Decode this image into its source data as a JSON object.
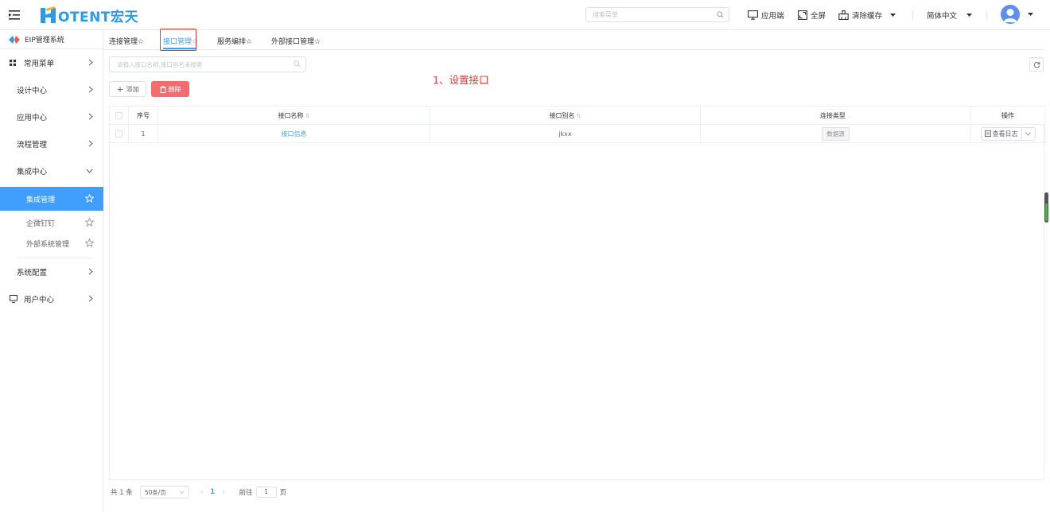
{
  "header": {
    "logo_text": "OTENT宏天",
    "search_placeholder": "搜索菜单",
    "app_client": "应用端",
    "fullscreen": "全屏",
    "clear_cache": "清除缓存",
    "language": "简体中文"
  },
  "sidebar": {
    "system_title": "EIP管理系统",
    "items": [
      {
        "label": "常用菜单"
      },
      {
        "label": "设计中心"
      },
      {
        "label": "应用中心"
      },
      {
        "label": "流程管理"
      },
      {
        "label": "集成中心"
      },
      {
        "label": "系统配置"
      },
      {
        "label": "用户中心"
      }
    ],
    "sub_items": [
      {
        "label": "集成管理",
        "active": true
      },
      {
        "label": "企微钉钉",
        "active": false
      },
      {
        "label": "外部系统管理",
        "active": false
      }
    ]
  },
  "tabs": [
    {
      "label": "连接管理☆",
      "active": false
    },
    {
      "label": "接口管理☆",
      "active": true
    },
    {
      "label": "服务编排☆",
      "active": false
    },
    {
      "label": "外部接口管理☆",
      "active": false
    }
  ],
  "toolbar": {
    "search_placeholder": "请输入接口名称,接口别名来搜索",
    "add_label": "添加",
    "delete_label": "删除"
  },
  "annotation": "1、设置接口",
  "table": {
    "columns": {
      "index": "序号",
      "name": "接口名称",
      "alias": "接口别名",
      "type": "连接类型",
      "ops": "操作"
    },
    "rows": [
      {
        "index": "1",
        "name": "接口信息",
        "alias": "jkxx",
        "type": "数据源",
        "action": "查看日志"
      }
    ]
  },
  "pagination": {
    "total": "共 1 条",
    "page_size": "50条/页",
    "current": "1",
    "goto_label": "前往",
    "goto_value": "1",
    "page_suffix": "页"
  },
  "colors": {
    "brand": "#2b9ae9",
    "primary": "#409eff",
    "danger": "#f56c6c",
    "annotation_red": "#e53935"
  }
}
